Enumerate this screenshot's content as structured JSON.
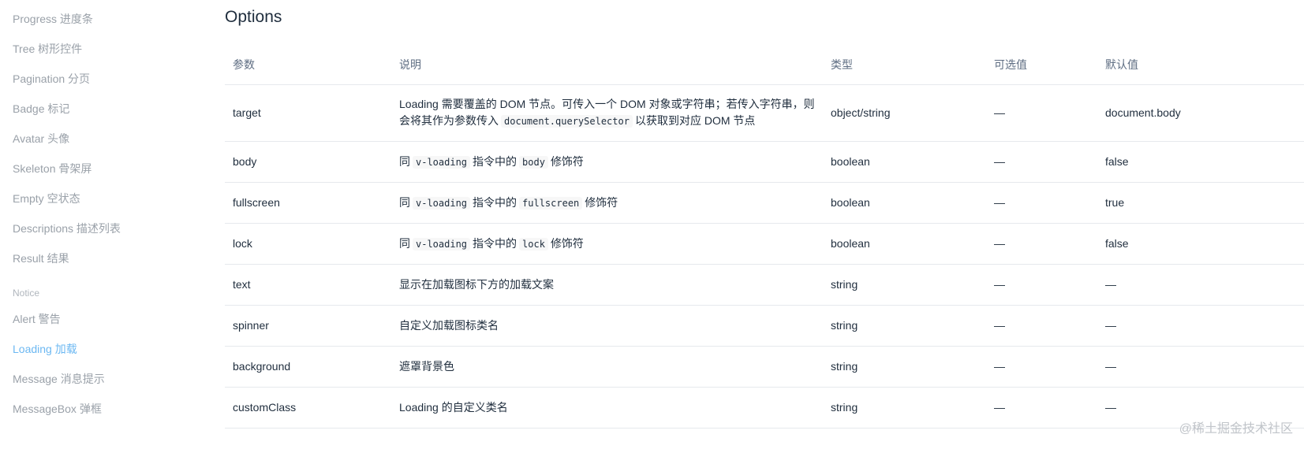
{
  "sidebar": {
    "items": [
      {
        "label": "Progress 进度条"
      },
      {
        "label": "Tree 树形控件"
      },
      {
        "label": "Pagination 分页"
      },
      {
        "label": "Badge 标记"
      },
      {
        "label": "Avatar 头像"
      },
      {
        "label": "Skeleton 骨架屏"
      },
      {
        "label": "Empty 空状态"
      },
      {
        "label": "Descriptions 描述列表"
      },
      {
        "label": "Result 结果"
      }
    ],
    "group_label": "Notice",
    "notice_items": [
      {
        "label": "Alert 警告"
      },
      {
        "label": "Loading 加载",
        "active": true
      },
      {
        "label": "Message 消息提示"
      },
      {
        "label": "MessageBox 弹框"
      }
    ],
    "active_color": "#6cb8f2",
    "item_color": "#9aa1a9"
  },
  "main": {
    "title": "Options",
    "table": {
      "headers": [
        "参数",
        "说明",
        "类型",
        "可选值",
        "默认值"
      ],
      "rows": [
        {
          "param": "target",
          "desc_parts": [
            "Loading 需要覆盖的 DOM 节点。可传入一个 DOM 对象或字符串；若传入字符串，则会将其作为参数传入",
            "document.querySelector",
            "以获取到对应 DOM 节点"
          ],
          "type": "object/string",
          "options": "—",
          "default": "document.body"
        },
        {
          "param": "body",
          "desc_parts": [
            "同",
            "v-loading",
            "指令中的",
            "body",
            "修饰符"
          ],
          "type": "boolean",
          "options": "—",
          "default": "false"
        },
        {
          "param": "fullscreen",
          "desc_parts": [
            "同",
            "v-loading",
            "指令中的",
            "fullscreen",
            "修饰符"
          ],
          "type": "boolean",
          "options": "—",
          "default": "true"
        },
        {
          "param": "lock",
          "desc_parts": [
            "同",
            "v-loading",
            "指令中的",
            "lock",
            "修饰符"
          ],
          "type": "boolean",
          "options": "—",
          "default": "false"
        },
        {
          "param": "text",
          "desc": "显示在加载图标下方的加载文案",
          "type": "string",
          "options": "—",
          "default": "—"
        },
        {
          "param": "spinner",
          "desc": "自定义加载图标类名",
          "type": "string",
          "options": "—",
          "default": "—"
        },
        {
          "param": "background",
          "desc": "遮罩背景色",
          "type": "string",
          "options": "—",
          "default": "—"
        },
        {
          "param": "customClass",
          "desc": "Loading 的自定义类名",
          "type": "string",
          "options": "—",
          "default": "—"
        }
      ]
    }
  },
  "watermark": "@稀土掘金技术社区"
}
